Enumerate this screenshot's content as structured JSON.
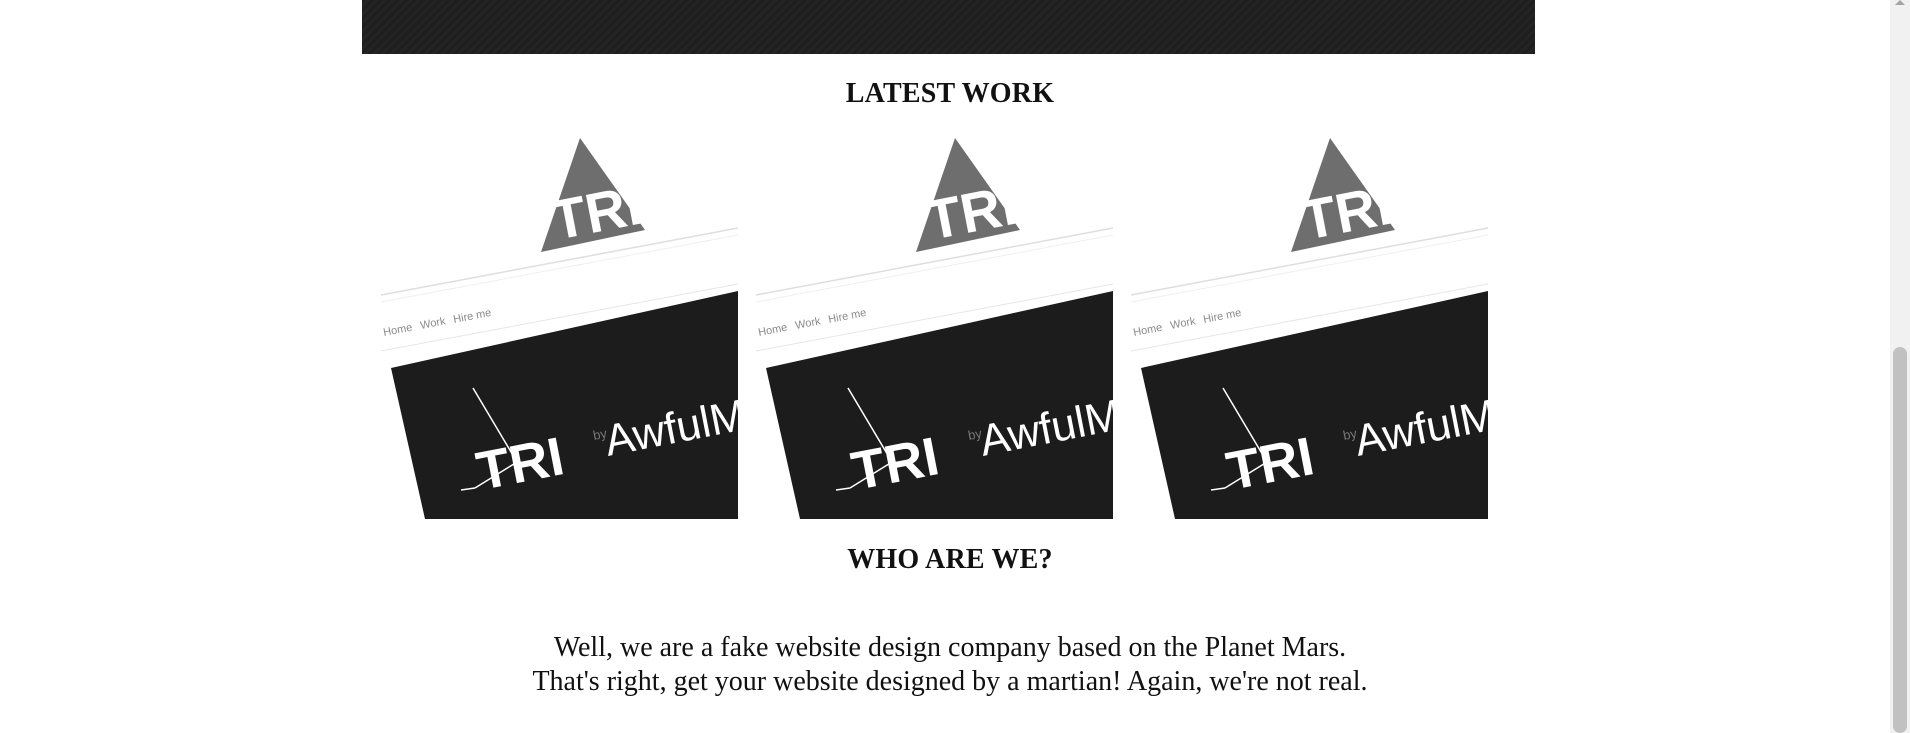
{
  "sections": {
    "latest_work_title": "LATEST WORK",
    "who_title": "WHO ARE WE?"
  },
  "portfolio": {
    "items": [
      {
        "logo_text": "TRI",
        "nav": [
          "Home",
          "Work",
          "Hire me"
        ],
        "by": "by",
        "brand": "AwfulM"
      },
      {
        "logo_text": "TRI",
        "nav": [
          "Home",
          "Work",
          "Hire me"
        ],
        "by": "by",
        "brand": "AwfulM"
      },
      {
        "logo_text": "TRI",
        "nav": [
          "Home",
          "Work",
          "Hire me"
        ],
        "by": "by",
        "brand": "AwfulM"
      }
    ]
  },
  "about": {
    "line1": "Well, we are a fake website design company based on the Planet Mars.",
    "line2": "That's right, get your website designed by a martian! Again, we're not real."
  },
  "colors": {
    "banner": "#1e1e1e",
    "logo_gray": "#6e6e6e",
    "screen_dark": "#1c1c1c"
  }
}
